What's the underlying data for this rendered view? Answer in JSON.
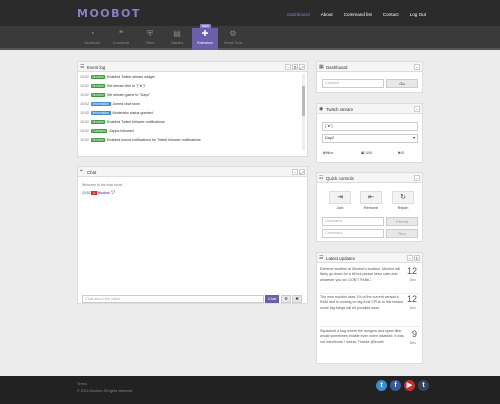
{
  "app": {
    "logo": "MOOBOT"
  },
  "topnav": [
    "Dashboard",
    "About",
    "Command list",
    "Contact",
    "Log Out"
  ],
  "iconbar": [
    {
      "icon": "gauge-icon",
      "glyph": "◔",
      "label": "Dashboard"
    },
    {
      "icon": "chat-bubbles-icon",
      "glyph": "❝",
      "label": "Commands"
    },
    {
      "icon": "shield-icon",
      "glyph": "⛨",
      "label": "Filters"
    },
    {
      "icon": "chart-icon",
      "glyph": "▤",
      "label": "Statistics"
    },
    {
      "icon": "puzzle-icon",
      "glyph": "✚",
      "label": "Extensions",
      "badge": "NEW"
    },
    {
      "icon": "gear-icon",
      "glyph": "⚙",
      "label": "Stream Tools"
    }
  ],
  "eventlog": {
    "title": "Event log",
    "rows": [
      {
        "time": "15:52",
        "tag": "Moobot",
        "tagtype": "moobot",
        "text": "Enabled Twitch stream widget"
      },
      {
        "time": "15:52",
        "tag": "Moobot",
        "tagtype": "moobot",
        "text": "Set stream title to \"(ᵔᴥᵔ)\""
      },
      {
        "time": "15:52",
        "tag": "Moobot",
        "tagtype": "moobot",
        "text": "Set stream game to \"Dayz\""
      },
      {
        "time": "15:52",
        "tag": "Information",
        "tagtype": "info",
        "text": "Joined chat room"
      },
      {
        "time": "15:52",
        "tag": "Information",
        "tagtype": "info",
        "text": "Moderator status granted"
      },
      {
        "time": "15:52",
        "tag": "Moobot",
        "tagtype": "moobot",
        "text": "Enabled Twitch follower notifications"
      },
      {
        "time": "15:52",
        "tag": "Followed",
        "tagtype": "followed",
        "text": "Zappa followed"
      },
      {
        "time": "15:52",
        "tag": "Moobot",
        "tagtype": "moobot",
        "text": "Enabled sound notifications for Twitch follower notifications"
      }
    ]
  },
  "chat": {
    "title": "Chat",
    "welcome": "Welcome to the chat room!",
    "line_time": "15:52",
    "line_user": "Moobot",
    "placeholder": "Chat about the video",
    "send_label": "Chat"
  },
  "dashboard": {
    "title": "Dashboard",
    "placeholder": "Channel",
    "go_label": "Go"
  },
  "stream": {
    "title": "Twitch stream",
    "title_value": "(ᵔᴥᵔ)",
    "game_value": "DayZ",
    "status": "Offline",
    "viewers": "82,598",
    "followers": "545"
  },
  "quick": {
    "title": "Quick controls",
    "join": "Join",
    "remove": "Remove",
    "rejoin": "Rejoin",
    "username_placeholder": "Username",
    "permit_label": "Permit",
    "command_placeholder": "Command",
    "run_label": "Run"
  },
  "updates": {
    "title": "Latest updates",
    "items": [
      {
        "text": "Extreme weather at Moobot's location. Moobot will likely go down for a bit but please keep calm and whatever you do: DON'T PANIC.",
        "day": "12",
        "mon": "Dec"
      },
      {
        "text": "The new moobot uses 1% of the current version's RAM and is running on big 8-bit CPUs to this means some big things will be possible soon.",
        "day": "12",
        "mon": "Dec"
      },
      {
        "text": "Squashed a bug where the dongers and spam filter would sometimes enable even when disabled. It was not intentional. I swear. Thanks @lenah!",
        "day": "9",
        "mon": "Dec"
      }
    ]
  },
  "footer": {
    "line1": "Terms",
    "line2": "© 2014 Moobot. All rights reserved."
  },
  "social": [
    {
      "icon": "twitter-icon",
      "glyph": "t",
      "color": "#3a8ec9"
    },
    {
      "icon": "facebook-icon",
      "glyph": "f",
      "color": "#3b5998"
    },
    {
      "icon": "youtube-icon",
      "glyph": "▶",
      "color": "#c4302b"
    },
    {
      "icon": "tumblr-icon",
      "glyph": "t",
      "color": "#35465c"
    }
  ]
}
